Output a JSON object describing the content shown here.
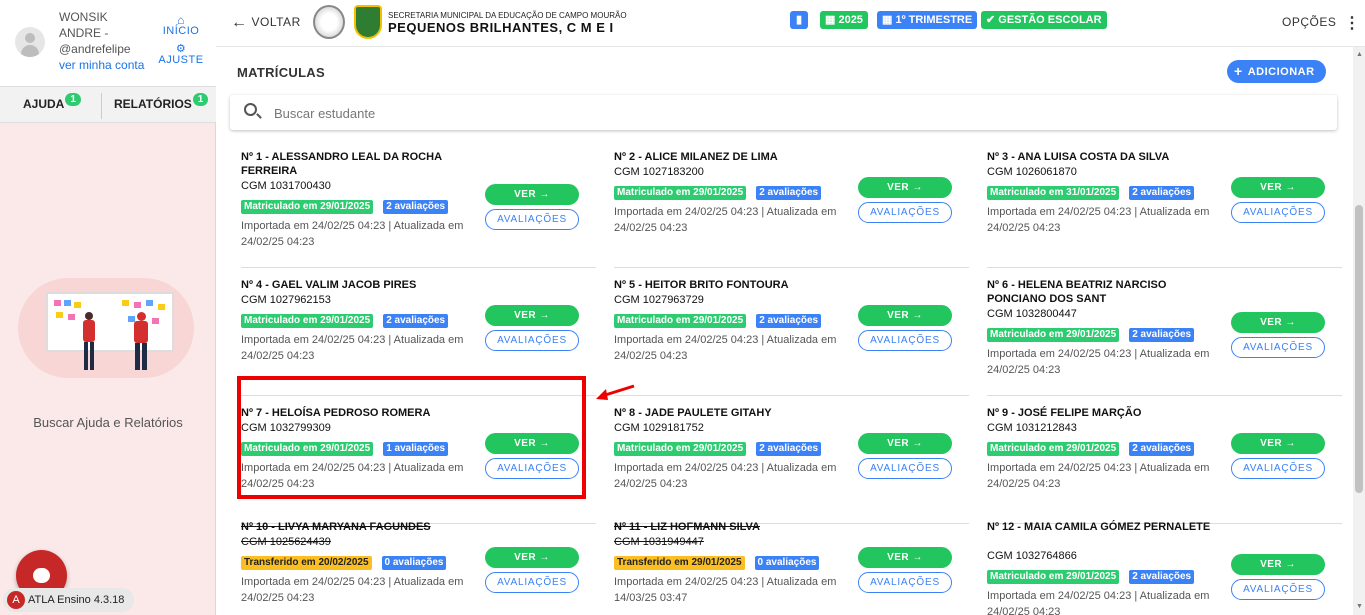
{
  "user": {
    "name_line1": "WONSIK",
    "name_line2": "ANDRE -",
    "handle": "@andrefelipe",
    "profile_link": "ver minha conta"
  },
  "sidebar_nav": {
    "home_label": "INÍCIO",
    "settings_label": "AJUSTE"
  },
  "sidebar_tabs": [
    {
      "label": "AJUDA",
      "badge": "1"
    },
    {
      "label": "RELATÓRIOS",
      "badge": "1"
    }
  ],
  "help_text": "Buscar Ajuda e Relatórios",
  "version": "ATLA Ensino 4.3.18",
  "topbar": {
    "back_label": "VOLTAR",
    "school_subtitle": "SECRETARIA MUNICIPAL DA EDUCAÇÃO DE CAMPO MOURÃO",
    "school_name": "PEQUENOS BRILHANTES, C M E I",
    "year": "2025",
    "term": "1º TRIMESTRE",
    "management": "GESTÃO ESCOLAR",
    "options_label": "OPÇÕES"
  },
  "main": {
    "title": "MATRÍCULAS",
    "add_label": "ADICIONAR",
    "search_placeholder": "Buscar estudante",
    "view_label": "VER →",
    "evals_label": "AVALIAÇÕES"
  },
  "students": [
    {
      "name": "Nº 1 - ALESSANDRO LEAL DA ROCHA FERREIRA",
      "cgm": "CGM 1031700430",
      "status": "Matriculado em 29/01/2025",
      "status_color": "#2ecc71",
      "evals": "2 avaliações",
      "info": "Importada em 24/02/25 04:23 | Atualizada em 24/02/25 04:23",
      "transferred": false
    },
    {
      "name": "Nº 2 - ALICE MILANEZ DE LIMA",
      "cgm": "CGM 1027183200",
      "status": "Matriculado em 29/01/2025",
      "status_color": "#2ecc71",
      "evals": "2 avaliações",
      "info": "Importada em 24/02/25 04:23 | Atualizada em 24/02/25 04:23",
      "transferred": false
    },
    {
      "name": "Nº 3 - ANA LUISA COSTA DA SILVA",
      "cgm": "CGM 1026061870",
      "status": "Matriculado em 31/01/2025",
      "status_color": "#2ecc71",
      "evals": "2 avaliações",
      "info": "Importada em 24/02/25 04:23 | Atualizada em 24/02/25 04:23",
      "transferred": false
    },
    {
      "name": "Nº 4 - GAEL VALIM JACOB PIRES",
      "cgm": "CGM 1027962153",
      "status": "Matriculado em 29/01/2025",
      "status_color": "#2ecc71",
      "evals": "2 avaliações",
      "info": "Importada em 24/02/25 04:23 | Atualizada em 24/02/25 04:23",
      "transferred": false
    },
    {
      "name": "Nº 5 - HEITOR BRITO FONTOURA",
      "cgm": "CGM 1027963729",
      "status": "Matriculado em 29/01/2025",
      "status_color": "#2ecc71",
      "evals": "2 avaliações",
      "info": "Importada em 24/02/25 04:23 | Atualizada em 24/02/25 04:23",
      "transferred": false
    },
    {
      "name": "Nº 6 - HELENA BEATRIZ NARCISO PONCIANO DOS SANT",
      "cgm": "CGM 1032800447",
      "status": "Matriculado em 29/01/2025",
      "status_color": "#2ecc71",
      "evals": "2 avaliações",
      "info": "Importada em 24/02/25 04:23 | Atualizada em 24/02/25 04:23",
      "transferred": false
    },
    {
      "name": "Nº 7 - HELOÍSA PEDROSO ROMERA",
      "cgm": "CGM 1032799309",
      "status": "Matriculado em 29/01/2025",
      "status_color": "#2ecc71",
      "evals": "1 avaliações",
      "info": "Importada em 24/02/25 04:23 | Atualizada em 24/02/25 04:23",
      "transferred": false
    },
    {
      "name": "Nº 8 - JADE PAULETE GITAHY",
      "cgm": "CGM 1029181752",
      "status": "Matriculado em 29/01/2025",
      "status_color": "#2ecc71",
      "evals": "2 avaliações",
      "info": "Importada em 24/02/25 04:23 | Atualizada em 24/02/25 04:23",
      "transferred": false
    },
    {
      "name": "Nº 9 - JOSÉ FELIPE MARÇÃO",
      "cgm": "CGM 1031212843",
      "status": "Matriculado em 29/01/2025",
      "status_color": "#2ecc71",
      "evals": "2 avaliações",
      "info": "Importada em 24/02/25 04:23 | Atualizada em 24/02/25 04:23",
      "transferred": false
    },
    {
      "name": "Nº 10 - LIVYA MARYANA FAGUNDES",
      "cgm": "CGM 1025624439",
      "status": "Transferido em 20/02/2025",
      "status_color": "#fbbf24",
      "evals": "0 avaliações",
      "info": "Importada em 24/02/25 04:23 | Atualizada em 24/02/25 04:23",
      "transferred": true
    },
    {
      "name": "Nº 11 - LIZ HOFMANN SILVA",
      "cgm": "CGM 1031949447",
      "status": "Transferido em 29/01/2025",
      "status_color": "#fbbf24",
      "evals": "0 avaliações",
      "info": "Importada em 24/02/25 04:23 | Atualizada em 14/03/25 03:47",
      "transferred": true
    },
    {
      "name": "Nº 12 - MAIA CAMILA GÓMEZ PERNALETE",
      "cgm": "CGM 1032764866",
      "status": "Matriculado em 29/01/2025",
      "status_color": "#2ecc71",
      "evals": "2 avaliações",
      "info": "Importada em 24/02/25 04:23 | Atualizada em 24/02/25 04:23",
      "transferred": false
    }
  ]
}
